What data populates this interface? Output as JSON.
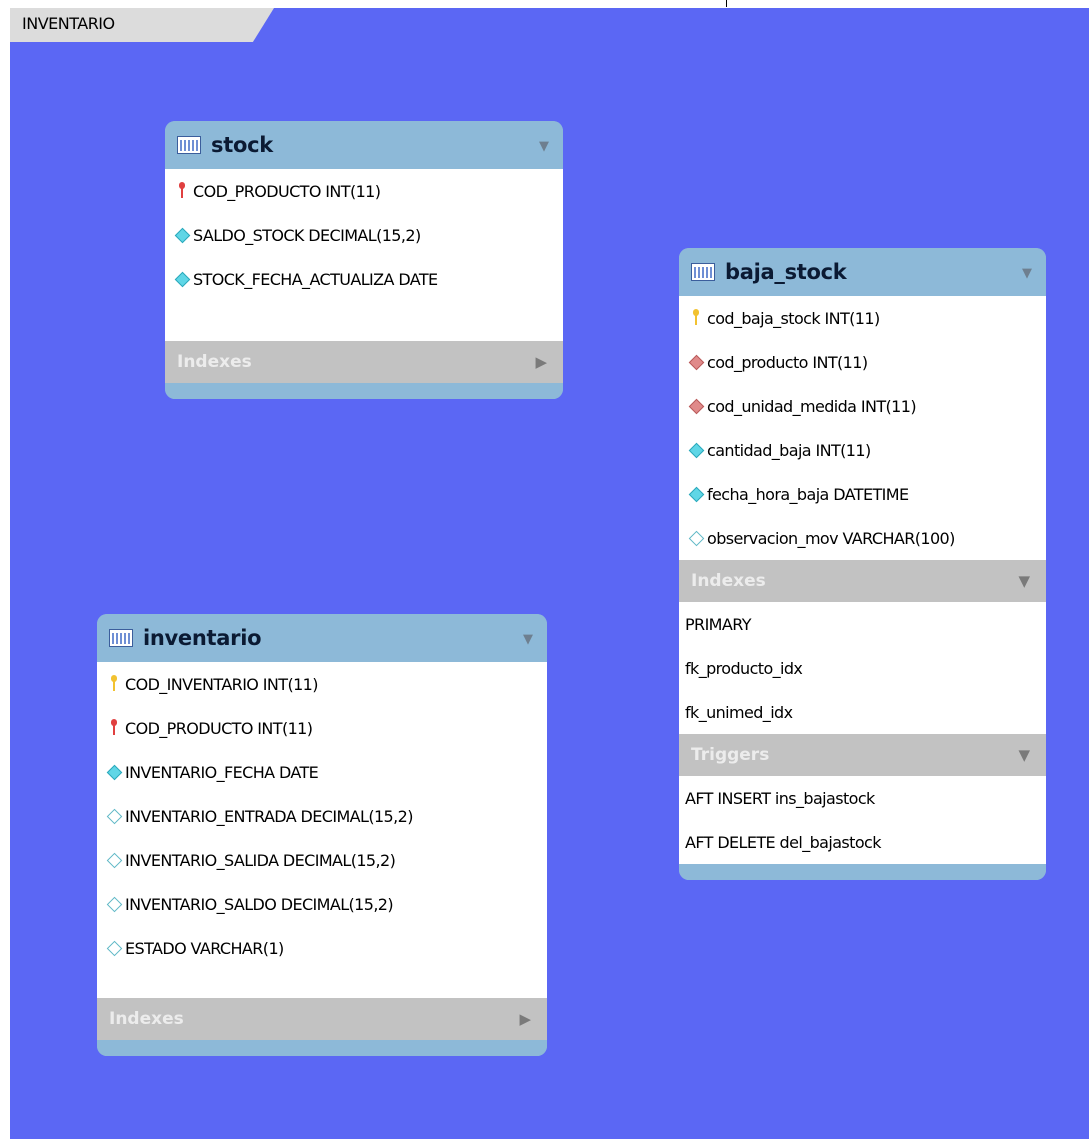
{
  "layer": {
    "name": "INVENTARIO"
  },
  "tables": {
    "stock": {
      "name": "stock",
      "columns": [
        {
          "icon": "key-red-icon",
          "label": "COD_PRODUCTO INT(11)"
        },
        {
          "icon": "diamond-filled-icon",
          "label": "SALDO_STOCK DECIMAL(15,2)"
        },
        {
          "icon": "diamond-filled-icon",
          "label": "STOCK_FECHA_ACTUALIZA DATE"
        }
      ],
      "indexes_label": "Indexes"
    },
    "baja_stock": {
      "name": "baja_stock",
      "columns": [
        {
          "icon": "key-yellow-icon",
          "label": "cod_baja_stock INT(11)"
        },
        {
          "icon": "diamond-red-icon",
          "label": "cod_producto INT(11)"
        },
        {
          "icon": "diamond-red-icon",
          "label": "cod_unidad_medida INT(11)"
        },
        {
          "icon": "diamond-filled-icon",
          "label": "cantidad_baja INT(11)"
        },
        {
          "icon": "diamond-filled-icon",
          "label": "fecha_hora_baja DATETIME"
        },
        {
          "icon": "diamond-empty-icon",
          "label": "observacion_mov VARCHAR(100)"
        }
      ],
      "indexes_label": "Indexes",
      "indexes": [
        "PRIMARY",
        "fk_producto_idx",
        "fk_unimed_idx"
      ],
      "triggers_label": "Triggers",
      "triggers": [
        "AFT INSERT ins_bajastock",
        "AFT DELETE del_bajastock"
      ]
    },
    "inventario": {
      "name": "inventario",
      "columns": [
        {
          "icon": "key-yellow-icon",
          "label": "COD_INVENTARIO INT(11)"
        },
        {
          "icon": "key-red-icon",
          "label": "COD_PRODUCTO INT(11)"
        },
        {
          "icon": "diamond-filled-icon",
          "label": "INVENTARIO_FECHA DATE"
        },
        {
          "icon": "diamond-empty-icon",
          "label": "INVENTARIO_ENTRADA DECIMAL(15,2)"
        },
        {
          "icon": "diamond-empty-icon",
          "label": "INVENTARIO_SALIDA DECIMAL(15,2)"
        },
        {
          "icon": "diamond-empty-icon",
          "label": "INVENTARIO_SALDO DECIMAL(15,2)"
        },
        {
          "icon": "diamond-empty-icon",
          "label": "ESTADO VARCHAR(1)"
        }
      ],
      "indexes_label": "Indexes"
    }
  },
  "colors": {
    "canvas": "#5b67f4",
    "table_header": "#8db9d8",
    "section_bar": "#c2c2c2"
  }
}
